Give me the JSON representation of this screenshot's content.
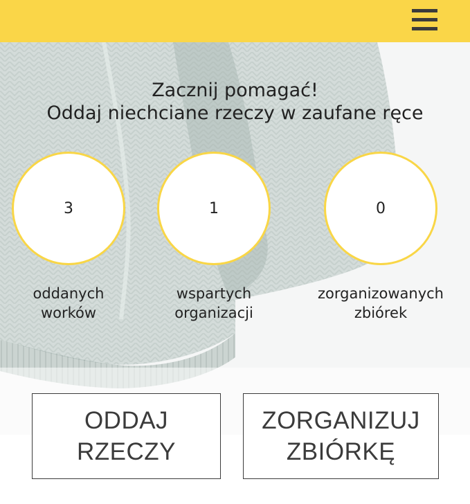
{
  "header": {
    "menu_icon": "hamburger-menu-icon",
    "background_color": "#fad648"
  },
  "hero": {
    "line1": "Zacznij pomagać!",
    "line2": "Oddaj niechciane rzeczy w zaufane ręce"
  },
  "stats": [
    {
      "value": "3",
      "label_line1": "oddanych",
      "label_line2": "worków"
    },
    {
      "value": "1",
      "label_line1": "wspartych",
      "label_line2": "organizacji"
    },
    {
      "value": "0",
      "label_line1": "zorganizowanych",
      "label_line2": "zbiórek"
    }
  ],
  "actions": {
    "give": {
      "label": "ODDAJ RZECZY"
    },
    "organize": {
      "label_line1": "ZORGANIZUJ",
      "label_line2": "ZBIÓRKĘ"
    }
  },
  "colors": {
    "accent": "#f9d646",
    "text": "#222222",
    "button_border": "#3b3b3b"
  }
}
